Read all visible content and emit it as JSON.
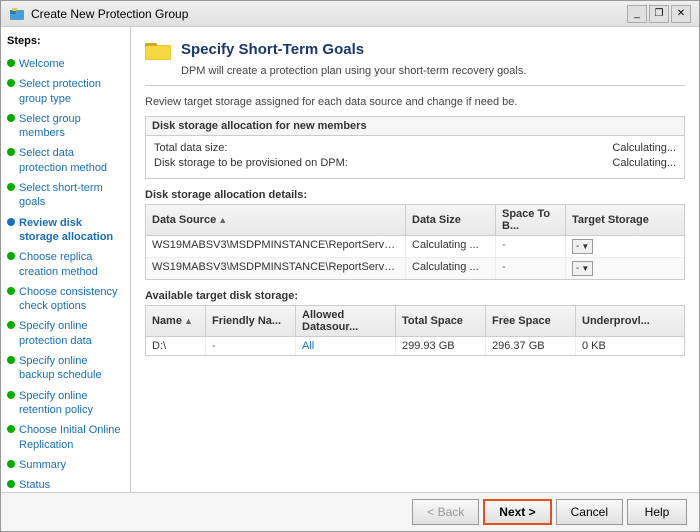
{
  "window": {
    "title": "Create New Protection Group",
    "controls": [
      "minimize",
      "restore",
      "close"
    ]
  },
  "header": {
    "icon": "folder",
    "title": "Specify Short-Term Goals",
    "subtitle": "DPM will create a protection plan using your short-term recovery goals."
  },
  "sidebar": {
    "steps_label": "Steps:",
    "items": [
      {
        "id": "welcome",
        "label": "Welcome",
        "dot": "green",
        "link": true
      },
      {
        "id": "select-protection-group-type",
        "label": "Select protection group type",
        "dot": "green",
        "link": true
      },
      {
        "id": "select-group-members",
        "label": "Select group members",
        "dot": "green",
        "link": true
      },
      {
        "id": "select-data-protection-method",
        "label": "Select data protection method",
        "dot": "green",
        "link": true
      },
      {
        "id": "select-short-term-goals",
        "label": "Select short-term goals",
        "dot": "green",
        "link": true
      },
      {
        "id": "review-disk-storage",
        "label": "Review disk storage allocation",
        "dot": "blue",
        "active": true,
        "link": true
      },
      {
        "id": "choose-replica",
        "label": "Choose replica creation method",
        "dot": "green",
        "link": true
      },
      {
        "id": "choose-consistency",
        "label": "Choose consistency check options",
        "dot": "green",
        "link": true
      },
      {
        "id": "specify-online-data",
        "label": "Specify online protection data",
        "dot": "green",
        "link": true
      },
      {
        "id": "specify-online-backup",
        "label": "Specify online backup schedule",
        "dot": "green",
        "link": true
      },
      {
        "id": "specify-online-retention",
        "label": "Specify online retention policy",
        "dot": "green",
        "link": true
      },
      {
        "id": "choose-initial-replication",
        "label": "Choose Initial Online Replication",
        "dot": "green",
        "link": true
      },
      {
        "id": "summary",
        "label": "Summary",
        "dot": "green",
        "link": true
      },
      {
        "id": "status",
        "label": "Status",
        "dot": "green",
        "link": true
      }
    ]
  },
  "main": {
    "description": "Review target storage assigned for each data source and change if need be.",
    "allocation_section": {
      "title": "Disk storage allocation for new members",
      "total_data_size_label": "Total data size:",
      "total_data_size_value": "Calculating...",
      "disk_storage_label": "Disk storage to be provisioned on DPM:",
      "disk_storage_value": "Calculating..."
    },
    "details_section": {
      "title": "Disk storage allocation details:",
      "columns": [
        {
          "id": "datasource",
          "label": "Data Source",
          "sortable": true
        },
        {
          "id": "datasize",
          "label": "Data Size"
        },
        {
          "id": "spacetob",
          "label": "Space To B..."
        },
        {
          "id": "targetstorage",
          "label": "Target Storage"
        }
      ],
      "rows": [
        {
          "datasource": "WS19MABSV3\\MSDPMINSTANCE\\ReportServe...",
          "datasize": "Calculating ...",
          "spacetob": "-",
          "targetstorage": "-"
        },
        {
          "datasource": "WS19MABSV3\\MSDPMINSTANCE\\ReportServe...",
          "datasize": "Calculating ...",
          "spacetob": "-",
          "targetstorage": "-"
        }
      ]
    },
    "available_section": {
      "title": "Available target disk storage:",
      "columns": [
        {
          "id": "name",
          "label": "Name",
          "sortable": true
        },
        {
          "id": "friendly",
          "label": "Friendly Na..."
        },
        {
          "id": "allowed",
          "label": "Allowed Datasour..."
        },
        {
          "id": "totalspace",
          "label": "Total Space"
        },
        {
          "id": "freespace",
          "label": "Free Space"
        },
        {
          "id": "underprov",
          "label": "Underprovl..."
        }
      ],
      "rows": [
        {
          "name": "D:\\",
          "friendly": "-",
          "allowed": "All",
          "totalspace": "299.93 GB",
          "freespace": "296.37 GB",
          "underprov": "0 KB"
        }
      ]
    }
  },
  "footer": {
    "back_label": "< Back",
    "next_label": "Next >",
    "cancel_label": "Cancel",
    "help_label": "Help"
  }
}
